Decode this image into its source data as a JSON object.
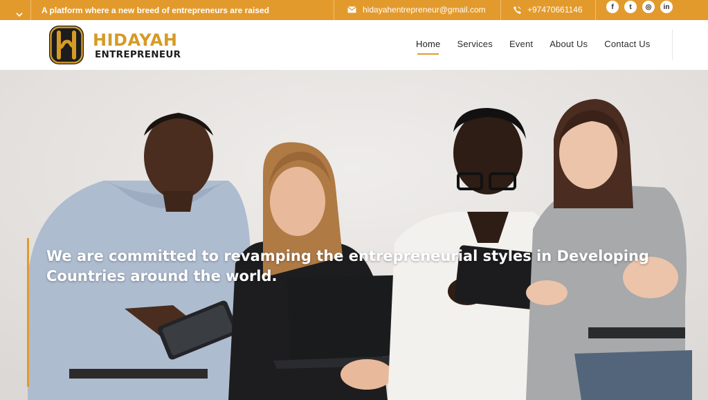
{
  "topbar": {
    "tagline": "A platform where a new breed of entrepreneurs are raised",
    "email": "hidayahentrepreneur@gmail.com",
    "phone": "+97470661146",
    "socials": [
      {
        "name": "facebook",
        "glyph": "f"
      },
      {
        "name": "twitter",
        "glyph": "t"
      },
      {
        "name": "instagram",
        "glyph": "◎"
      },
      {
        "name": "linkedin",
        "glyph": "in"
      }
    ],
    "colors": {
      "accent": "#e39a2c"
    }
  },
  "logo": {
    "title": "HIDAYAH",
    "subtitle": "ENTREPRENEUR",
    "colors": {
      "gold": "#d69a26",
      "dark": "#1d1d1d"
    }
  },
  "nav": {
    "items": [
      {
        "label": "Home",
        "active": true
      },
      {
        "label": "Services",
        "active": false
      },
      {
        "label": "Event",
        "active": false
      },
      {
        "label": "About Us",
        "active": false
      },
      {
        "label": "Contact Us",
        "active": false
      }
    ]
  },
  "hero": {
    "heading": "We are committed to revamping the entrepreneurial styles in Developing Countries around the world."
  }
}
